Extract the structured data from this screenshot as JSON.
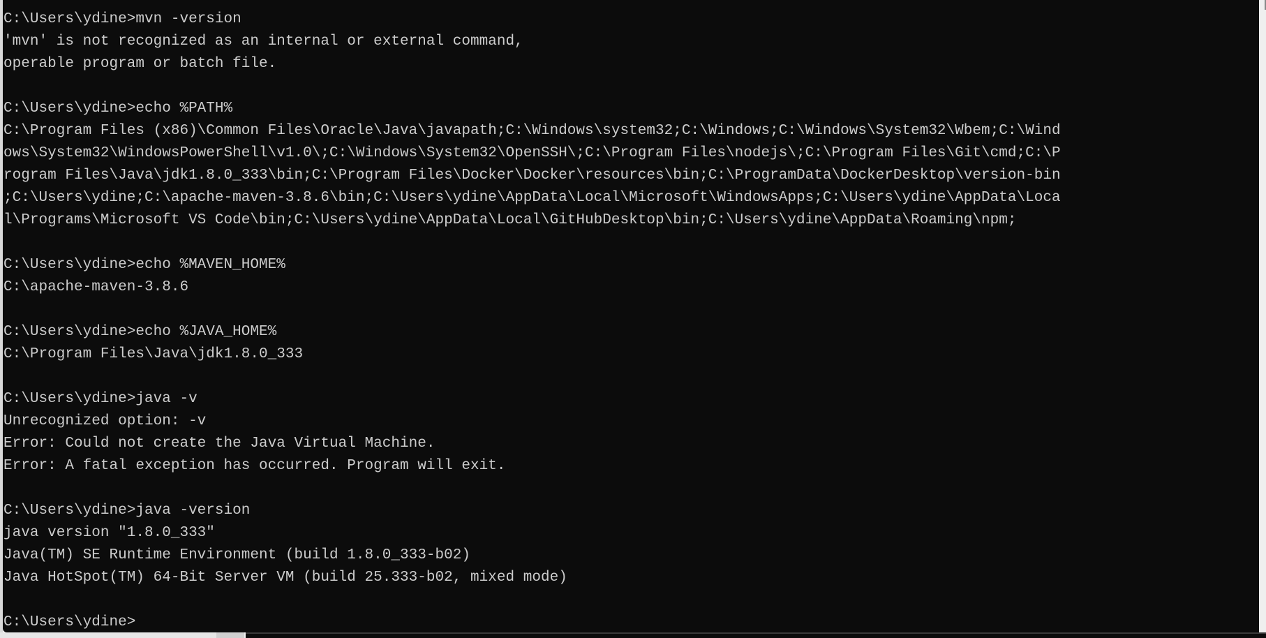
{
  "terminal": {
    "background": "#0c0c0c",
    "foreground": "#cccccc",
    "lines": [
      "C:\\Users\\ydine>mvn -version",
      "'mvn' is not recognized as an internal or external command,",
      "operable program or batch file.",
      "",
      "C:\\Users\\ydine>echo %PATH%",
      "C:\\Program Files (x86)\\Common Files\\Oracle\\Java\\javapath;C:\\Windows\\system32;C:\\Windows;C:\\Windows\\System32\\Wbem;C:\\Wind",
      "ows\\System32\\WindowsPowerShell\\v1.0\\;C:\\Windows\\System32\\OpenSSH\\;C:\\Program Files\\nodejs\\;C:\\Program Files\\Git\\cmd;C:\\P",
      "rogram Files\\Java\\jdk1.8.0_333\\bin;C:\\Program Files\\Docker\\Docker\\resources\\bin;C:\\ProgramData\\DockerDesktop\\version-bin",
      ";C:\\Users\\ydine;C:\\apache-maven-3.8.6\\bin;C:\\Users\\ydine\\AppData\\Local\\Microsoft\\WindowsApps;C:\\Users\\ydine\\AppData\\Loca",
      "l\\Programs\\Microsoft VS Code\\bin;C:\\Users\\ydine\\AppData\\Local\\GitHubDesktop\\bin;C:\\Users\\ydine\\AppData\\Roaming\\npm;",
      "",
      "C:\\Users\\ydine>echo %MAVEN_HOME%",
      "C:\\apache-maven-3.8.6",
      "",
      "C:\\Users\\ydine>echo %JAVA_HOME%",
      "C:\\Program Files\\Java\\jdk1.8.0_333",
      "",
      "C:\\Users\\ydine>java -v",
      "Unrecognized option: -v",
      "Error: Could not create the Java Virtual Machine.",
      "Error: A fatal exception has occurred. Program will exit.",
      "",
      "C:\\Users\\ydine>java -version",
      "java version \"1.8.0_333\"",
      "Java(TM) SE Runtime Environment (build 1.8.0_333-b02)",
      "Java HotSpot(TM) 64-Bit Server VM (build 25.333-b02, mixed mode)",
      "",
      "C:\\Users\\ydine>"
    ]
  }
}
